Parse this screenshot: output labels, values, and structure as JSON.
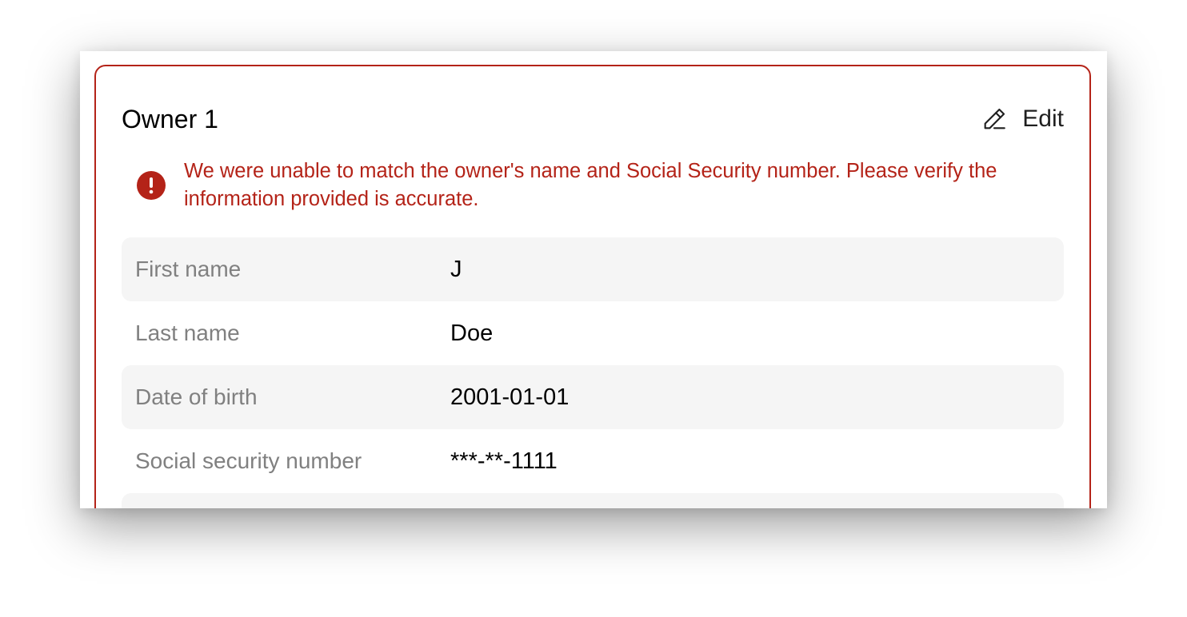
{
  "owner_card": {
    "title": "Owner 1",
    "edit_label": "Edit",
    "edit_icon": "pencil-icon",
    "alert": {
      "icon": "exclamation-circle-icon",
      "message": "We were unable to match the owner's name and Social Security number. Please verify the information provided is accurate.",
      "color": "#b42318"
    },
    "fields": [
      {
        "label": "First name",
        "value": "J"
      },
      {
        "label": "Last name",
        "value": "Doe"
      },
      {
        "label": "Date of birth",
        "value": "2001-01-01"
      },
      {
        "label": "Social security number",
        "value": "***-**-1111"
      },
      {
        "label": "",
        "value": ""
      }
    ]
  },
  "colors": {
    "error": "#b42318",
    "row_shade": "#f5f5f5",
    "label_text": "#808080"
  }
}
